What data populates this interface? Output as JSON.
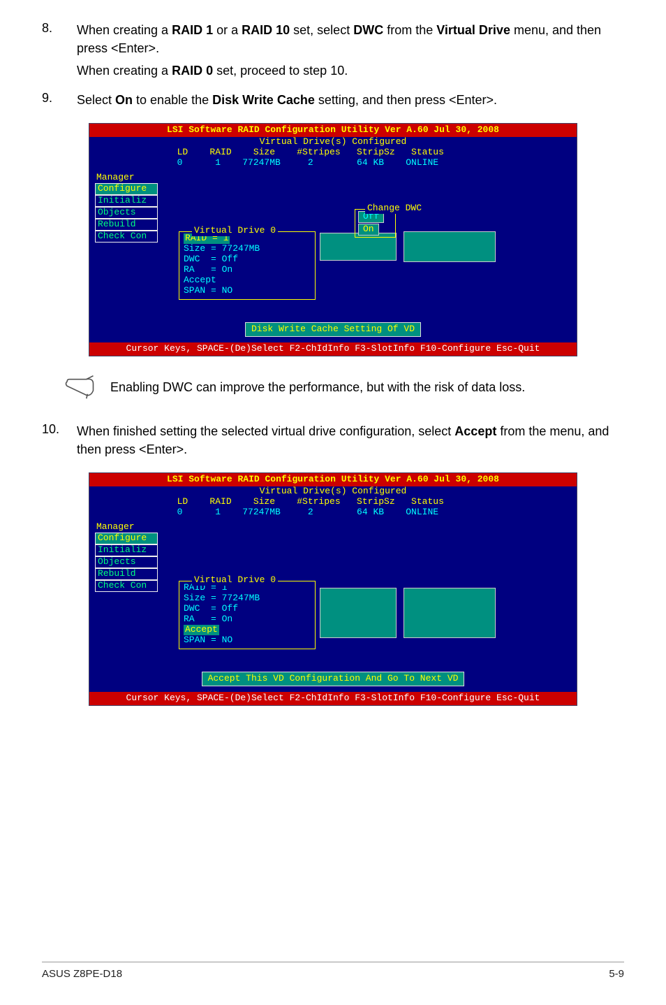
{
  "step8": {
    "num": "8.",
    "line1_pre": "When creating a ",
    "raid1": "RAID 1",
    "line1_mid1": " or a ",
    "raid10": "RAID 10",
    "line1_mid2": " set, select ",
    "dwc": "DWC",
    "line1_mid3": " from the ",
    "vd": "Virtual Drive",
    "line1_post": " menu, and then press <Enter>.",
    "line2_pre": "When creating a ",
    "raid0": "RAID 0",
    "line2_post": " set, proceed to step 10."
  },
  "step9": {
    "num": "9.",
    "pre": "Select ",
    "on": "On",
    "mid": " to enable the ",
    "dwcache": "Disk Write Cache",
    "post": " setting, and then press <Enter>."
  },
  "step10": {
    "num": "10.",
    "pre": "When finished setting the selected virtual drive configuration, select ",
    "accept": "Accept",
    "post": " from the menu, and then press <Enter>."
  },
  "note": "Enabling DWC can improve the performance, but with the risk of data loss.",
  "bios": {
    "title": "LSI Software RAID Configuration Utility Ver A.60 Jul 30, 2008",
    "subtitle": "Virtual Drive(s) Configured",
    "head": "  LD    RAID    Size    #Stripes   StripSz   Status",
    "row": "  0      1    77247MB     2        64 KB    ONLINE",
    "menu_label": "Manager",
    "menu": [
      "Configure",
      "Initializ",
      "Objects",
      "Rebuild",
      "Check Con"
    ],
    "dwc_title": "Change DWC",
    "dwc_off": "Off",
    "dwc_on": "On",
    "vd0_title": "Virtual Drive 0",
    "vd0_lines": [
      "RAID = 1",
      "Size = 77247MB",
      "DWC  = Off",
      "RA   = On",
      "Accept",
      "SPAN = NO"
    ],
    "msg1": "Disk Write Cache Setting Of VD",
    "msg2": "Accept This VD Configuration And Go To Next VD",
    "footer": "Cursor Keys, SPACE-(De)Select F2-ChIdInfo F3-SlotInfo F10-Configure Esc-Quit"
  },
  "page": {
    "product": "ASUS Z8PE-D18",
    "num": "5-9"
  }
}
